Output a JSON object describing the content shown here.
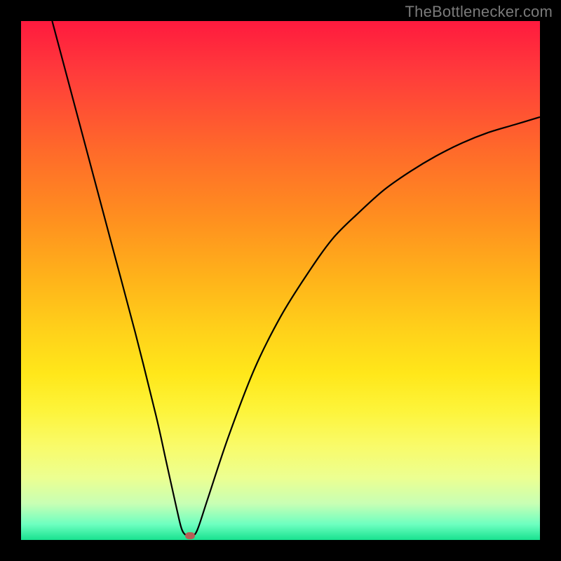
{
  "watermark": "TheBottlenecker.com",
  "colors": {
    "frame": "#000000",
    "curve": "#000000",
    "marker": "#b65e55"
  },
  "chart_data": {
    "type": "line",
    "title": "",
    "xlabel": "",
    "ylabel": "",
    "xlim": [
      0,
      100
    ],
    "ylim": [
      0,
      100
    ],
    "annotations": [],
    "series": [
      {
        "name": "bottleneck-curve",
        "x": [
          6,
          10,
          14,
          18,
          22,
          26,
          28,
          30,
          31,
          32,
          33,
          34,
          36,
          40,
          45,
          50,
          55,
          60,
          65,
          70,
          75,
          80,
          85,
          90,
          95,
          100
        ],
        "values": [
          100,
          85,
          70,
          55,
          40,
          24,
          15,
          6,
          2,
          0.8,
          0.8,
          2,
          8,
          20,
          33,
          43,
          51,
          58,
          63,
          67.5,
          71,
          74,
          76.5,
          78.5,
          80,
          81.5
        ]
      }
    ],
    "marker": {
      "x": 32.5,
      "y": 0.8
    },
    "background_gradient": [
      "#ff1a3e",
      "#ff3b3b",
      "#ff6a2a",
      "#ff8f1f",
      "#ffb41a",
      "#ffd21a",
      "#ffe71a",
      "#fdf43a",
      "#f9fb6a",
      "#ecff91",
      "#c8ffb4",
      "#6dffc0",
      "#18e28f"
    ]
  }
}
